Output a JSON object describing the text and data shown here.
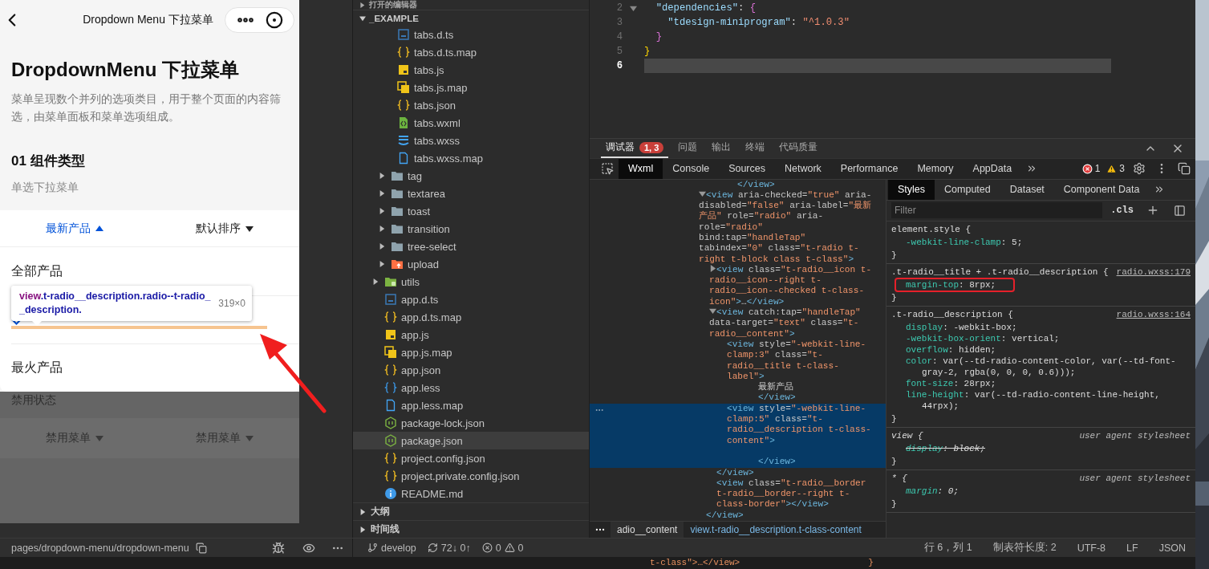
{
  "simulator": {
    "nav_title": "Dropdown Menu 下拉菜单",
    "page_title": "DropdownMenu 下拉菜单",
    "description": "菜单呈现数个并列的选项类目，用于整个页面的内容筛选，由菜单面板和菜单选项组成。",
    "section_title": "01 组件类型",
    "section_subtitle": "单选下拉菜单",
    "menu_bar": [
      {
        "label": "最新产品",
        "selected": true,
        "expanded": true
      },
      {
        "label": "默认排序",
        "selected": false,
        "expanded": false
      }
    ],
    "options": [
      {
        "label": "全部产品",
        "selected": false
      },
      {
        "selected": true
      },
      {
        "label": "最火产品",
        "selected": false
      }
    ],
    "disabled_title": "禁用状态",
    "disabled_menu": [
      {
        "label": "禁用菜单"
      },
      {
        "label": "禁用菜单"
      }
    ],
    "inspector_tooltip": {
      "tag": "view",
      "selector": ".t-radio__description.radio--t-radio__description.",
      "size": "319×0"
    },
    "path": "pages/dropdown-menu/dropdown-menu"
  },
  "explorer": {
    "open_editors": "打开的编辑器",
    "root": "_EXAMPLE",
    "root_expanded": true,
    "items": [
      {
        "children": [
          {
            "children": [
              {
                "name": "tabs.d.ts",
                "kind": "ts",
                "selected": false
              },
              {
                "name": "tabs.d.ts.map",
                "kind": "json",
                "selected": false
              },
              {
                "name": "tabs.js",
                "kind": "js",
                "selected": false
              },
              {
                "name": "tabs.js.map",
                "kind": "jsmap",
                "selected": false
              },
              {
                "name": "tabs.json",
                "kind": "json",
                "selected": false
              },
              {
                "name": "tabs.wxml",
                "kind": "wxml",
                "selected": false
              },
              {
                "name": "tabs.wxss",
                "kind": "wxss",
                "selected": false
              },
              {
                "name": "tabs.wxss.map",
                "kind": "file",
                "selected": false
              }
            ]
          },
          {
            "name": "tag",
            "kind": "folder",
            "expanded": false,
            "selected": false
          },
          {
            "name": "textarea",
            "kind": "folder",
            "expanded": false,
            "selected": false
          },
          {
            "name": "toast",
            "kind": "folder",
            "expanded": false,
            "selected": false
          },
          {
            "name": "transition",
            "kind": "folder",
            "expanded": false,
            "selected": false
          },
          {
            "name": "tree-select",
            "kind": "folder",
            "expanded": false,
            "selected": false
          },
          {
            "name": "upload",
            "kind": "folder-upload",
            "expanded": false,
            "selected": false
          }
        ]
      },
      {
        "name": "utils",
        "kind": "folder-utils",
        "expanded": false,
        "selected": false
      },
      {
        "name": "app.d.ts",
        "kind": "ts",
        "selected": false
      },
      {
        "name": "app.d.ts.map",
        "kind": "json",
        "selected": false
      },
      {
        "name": "app.js",
        "kind": "js",
        "selected": false
      },
      {
        "name": "app.js.map",
        "kind": "jsmap",
        "selected": false
      },
      {
        "name": "app.json",
        "kind": "json",
        "selected": false
      },
      {
        "name": "app.less",
        "kind": "less",
        "selected": false
      },
      {
        "name": "app.less.map",
        "kind": "file",
        "selected": false
      },
      {
        "name": "package-lock.json",
        "kind": "npm",
        "selected": false
      },
      {
        "name": "package.json",
        "kind": "npm",
        "selected": true
      },
      {
        "name": "project.config.json",
        "kind": "json",
        "selected": false
      },
      {
        "name": "project.private.config.json",
        "kind": "json",
        "selected": false
      },
      {
        "name": "README.md",
        "kind": "info",
        "selected": false
      }
    ],
    "panels": [
      {
        "label": "大纲",
        "expanded": false
      },
      {
        "label": "时间线",
        "expanded": false
      }
    ]
  },
  "editor": {
    "lines": [
      {
        "number": "2",
        "current": false,
        "foldable": true,
        "tokens": [
          {
            "text": "  \"dependencies\"",
            "kind": "key"
          },
          {
            "text": ": ",
            "kind": "punct"
          },
          {
            "text": "{",
            "kind": "brace2"
          }
        ]
      },
      {
        "number": "3",
        "current": false,
        "foldable": false,
        "tokens": [
          {
            "text": "    \"tdesign-miniprogram\"",
            "kind": "key"
          },
          {
            "text": ": ",
            "kind": "punct"
          },
          {
            "text": "\"^1.0.3\"",
            "kind": "str"
          }
        ]
      },
      {
        "number": "4",
        "current": false,
        "foldable": false,
        "tokens": [
          {
            "text": "  }",
            "kind": "brace2"
          }
        ]
      },
      {
        "number": "5",
        "current": false,
        "foldable": false,
        "tokens": [
          {
            "text": "}",
            "kind": "brace1"
          }
        ]
      },
      {
        "number": "6",
        "current": true,
        "foldable": false
      }
    ]
  },
  "devtools": {
    "panel_tabs": [
      {
        "label": "调试器",
        "selected": true,
        "badge": "1, 3"
      },
      {
        "label": "问题",
        "selected": false
      },
      {
        "label": "输出",
        "selected": false
      },
      {
        "label": "终端",
        "selected": false
      },
      {
        "label": "代码质量",
        "selected": false
      }
    ],
    "tool_tabs": [
      {
        "label": "Wxml",
        "selected": true
      },
      {
        "label": "Console",
        "selected": false
      },
      {
        "label": "Sources",
        "selected": false
      },
      {
        "label": "Network",
        "selected": false
      },
      {
        "label": "Performance",
        "selected": false
      },
      {
        "label": "Memory",
        "selected": false
      },
      {
        "label": "AppData",
        "selected": false
      }
    ],
    "errors": "1",
    "warnings": "3",
    "dom": [
      {
        "close": [
          {
            "text": "</view>",
            "kind": "tag"
          }
        ]
      },
      {
        "expanded": true,
        "selected": false,
        "tokens": [
          {
            "text": "<view",
            "kind": "tag"
          },
          {
            "text": " aria-checked=",
            "kind": "attr"
          },
          {
            "text": "\"true\"",
            "kind": "value"
          },
          {
            "text": " aria-disabled=",
            "kind": "attr"
          },
          {
            "text": "\"false\"",
            "kind": "value"
          },
          {
            "text": " aria-label=",
            "kind": "attr"
          },
          {
            "text": "\"最新产品\"",
            "kind": "value"
          },
          {
            "text": " role=",
            "kind": "attr"
          },
          {
            "text": "\"radio\"",
            "kind": "value"
          },
          {
            "text": " aria-role=",
            "kind": "attr"
          },
          {
            "text": "\"radio\"",
            "kind": "value"
          },
          {
            "text": " bind:tap=",
            "kind": "attr"
          },
          {
            "text": "\"handleTap\"",
            "kind": "value"
          },
          {
            "text": " tabindex=",
            "kind": "attr"
          },
          {
            "text": "\"0\"",
            "kind": "value"
          },
          {
            "text": " class=",
            "kind": "attr"
          },
          {
            "text": "\"t-radio t-right t-block class t-class\"",
            "kind": "value"
          },
          {
            "text": ">",
            "kind": "tag"
          }
        ],
        "children": [
          {
            "expanded": false,
            "selected": false,
            "tokens": [
              {
                "text": "<view",
                "kind": "tag"
              },
              {
                "text": " class=",
                "kind": "attr"
              },
              {
                "text": "\"t-radio__icon t-radio__icon--right t-radio__icon--checked t-class-icon\"",
                "kind": "value"
              },
              {
                "text": ">",
                "kind": "tag"
              },
              {
                "text": "…",
                "kind": "text"
              },
              {
                "text": "</view>",
                "kind": "tag"
              }
            ]
          },
          {
            "expanded": true,
            "selected": false,
            "tokens": [
              {
                "text": "<view",
                "kind": "tag"
              },
              {
                "text": " catch:tap=",
                "kind": "attr"
              },
              {
                "text": "\"handleTap\"",
                "kind": "value"
              },
              {
                "text": " data-target=",
                "kind": "attr"
              },
              {
                "text": "\"text\"",
                "kind": "value"
              },
              {
                "text": " class=",
                "kind": "attr"
              },
              {
                "text": "\"t-radio__content\"",
                "kind": "value"
              },
              {
                "text": ">",
                "kind": "tag"
              }
            ],
            "children": [
              {
                "selected": false,
                "tokens": [
                  {
                    "text": "<view",
                    "kind": "tag"
                  },
                  {
                    "text": " style=",
                    "kind": "attr"
                  },
                  {
                    "text": "\"-webkit-line-clamp:3\"",
                    "kind": "value"
                  },
                  {
                    "text": " class=",
                    "kind": "attr"
                  },
                  {
                    "text": "\"t-radio__title t-class-label\"",
                    "kind": "value"
                  },
                  {
                    "text": ">",
                    "kind": "tag"
                  }
                ],
                "children": [
                  {
                    "text": "最新产品"
                  }
                ],
                "close": [
                  {
                    "text": "</view>",
                    "kind": "tag"
                  }
                ]
              },
              {
                "selected": true,
                "tokens": [
                  {
                    "text": "<view",
                    "kind": "tag"
                  },
                  {
                    "text": " style=",
                    "kind": "attr"
                  },
                  {
                    "text": "\"-webkit-line-clamp:5\"",
                    "kind": "value"
                  },
                  {
                    "text": " class=",
                    "kind": "attr"
                  },
                  {
                    "text": "\"t-radio__description t-class-content\"",
                    "kind": "value"
                  },
                  {
                    "text": ">",
                    "kind": "tag"
                  }
                ],
                "close": [
                  {
                    "text": "</view>",
                    "kind": "tag"
                  }
                ]
              }
            ],
            "close": [
              {
                "text": "</view>",
                "kind": "tag"
              }
            ]
          },
          {
            "selected": false,
            "tokens": [
              {
                "text": "<view",
                "kind": "tag"
              },
              {
                "text": " class=",
                "kind": "attr"
              },
              {
                "text": "\"t-radio__border t-radio__border--right t-class-border\"",
                "kind": "value"
              },
              {
                "text": "></view>",
                "kind": "tag"
              }
            ]
          }
        ],
        "close": [
          {
            "text": "</view>",
            "kind": "tag"
          }
        ]
      }
    ],
    "breadcrumbs": [
      {
        "label": "adio__content",
        "selected": false
      },
      {
        "label": "view.t-radio__description.t-class-content",
        "selected": true
      }
    ],
    "style_tabs": [
      {
        "label": "Styles",
        "selected": true
      },
      {
        "label": "Computed",
        "selected": false
      },
      {
        "label": "Dataset",
        "selected": false
      },
      {
        "label": "Component Data",
        "selected": false
      }
    ],
    "filter_placeholder": "Filter",
    "cls": ".cls",
    "rules": [
      {
        "kind": "inline",
        "selector": "element.style {",
        "annotated": false,
        "decls": [
          {
            "prop": "-webkit-line-clamp",
            "value": ": 5;",
            "struck": false
          }
        ],
        "close": "}"
      },
      {
        "kind": "author",
        "selector": ".t-radio__title + .t-radio__description {",
        "source": "radio.wxss:179",
        "annotated": true,
        "decls": [
          {
            "prop": "margin-top",
            "value": ": 8rpx;",
            "struck": false
          }
        ],
        "close": "}"
      },
      {
        "kind": "author",
        "selector": ".t-radio__description {",
        "source": "radio.wxss:164",
        "annotated": false,
        "decls": [
          {
            "prop": "display",
            "value": ": -webkit-box;",
            "struck": false
          },
          {
            "prop": "-webkit-box-orient",
            "value": ": vertical;",
            "struck": false
          },
          {
            "prop": "overflow",
            "value": ": hidden;",
            "struck": false
          },
          {
            "prop": "color",
            "value": ": var(--td-radio-content-color, var(--td-font-gray-2, rgba(0, 0, 0, 0.6)));",
            "struck": false
          },
          {
            "prop": "font-size",
            "value": ": 28rpx;",
            "struck": false
          },
          {
            "prop": "line-height",
            "value": ": var(--td-radio-content-line-height, 44rpx);",
            "struck": false
          }
        ],
        "close": "}"
      },
      {
        "kind": "user-agent",
        "selector": "view {",
        "source": "user agent stylesheet",
        "annotated": false,
        "decls": [
          {
            "prop": "display",
            "value": ": block;",
            "struck": true
          }
        ],
        "close": "}"
      },
      {
        "kind": "user-agent",
        "selector": "* {",
        "source": "user agent stylesheet",
        "annotated": false,
        "decls": [
          {
            "prop": "margin",
            "value": ": 0;",
            "struck": false
          }
        ],
        "close": "}"
      }
    ]
  },
  "status_bar": {
    "branch": "develop",
    "sync": "72↓ 0↑",
    "errors": "0",
    "warnings": "0",
    "items": [
      "行 6，列 1",
      "制表符长度: 2",
      "UTF-8",
      "LF",
      "JSON"
    ]
  },
  "underlay": [
    {
      "text": "t-class\">…</view>"
    },
    {
      "text": "}"
    }
  ]
}
